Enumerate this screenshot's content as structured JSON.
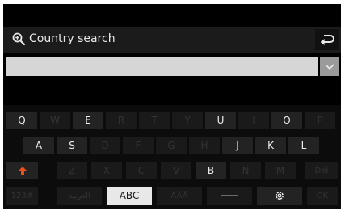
{
  "header": {
    "title": "Country search"
  },
  "search": {
    "value": "",
    "placeholder": ""
  },
  "keyboard": {
    "row1": [
      {
        "label": "Q",
        "enabled": true
      },
      {
        "label": "W",
        "enabled": false
      },
      {
        "label": "E",
        "enabled": true
      },
      {
        "label": "R",
        "enabled": false
      },
      {
        "label": "T",
        "enabled": false
      },
      {
        "label": "Y",
        "enabled": false
      },
      {
        "label": "U",
        "enabled": true
      },
      {
        "label": "I",
        "enabled": false
      },
      {
        "label": "O",
        "enabled": true
      },
      {
        "label": "P",
        "enabled": false
      }
    ],
    "row2": [
      {
        "label": "A",
        "enabled": true
      },
      {
        "label": "S",
        "enabled": true
      },
      {
        "label": "D",
        "enabled": false
      },
      {
        "label": "F",
        "enabled": false
      },
      {
        "label": "G",
        "enabled": false
      },
      {
        "label": "H",
        "enabled": false
      },
      {
        "label": "J",
        "enabled": true
      },
      {
        "label": "K",
        "enabled": true
      },
      {
        "label": "L",
        "enabled": true
      }
    ],
    "row3": [
      {
        "label": "Z",
        "enabled": false
      },
      {
        "label": "X",
        "enabled": false
      },
      {
        "label": "C",
        "enabled": false
      },
      {
        "label": "V",
        "enabled": false
      },
      {
        "label": "B",
        "enabled": true
      },
      {
        "label": "N",
        "enabled": false
      },
      {
        "label": "M",
        "enabled": false
      }
    ],
    "delete_label": "Del",
    "mode_numeric_label": "123#",
    "mode_arabic_label": "العربية",
    "mode_abc_label": "ABC",
    "mode_accent_label": "ÀÂÄ",
    "ok_label": "OK"
  },
  "colors": {
    "shift_arrow": "#e8501e",
    "display_background": "#000000",
    "selected_key": "#e8e8e8"
  },
  "icons": {
    "search": "magnifier-with-plus",
    "back": "return-arrow",
    "dropdown": "chevron-down",
    "shift": "up-arrow",
    "space": "space-bar",
    "settings": "gear"
  }
}
